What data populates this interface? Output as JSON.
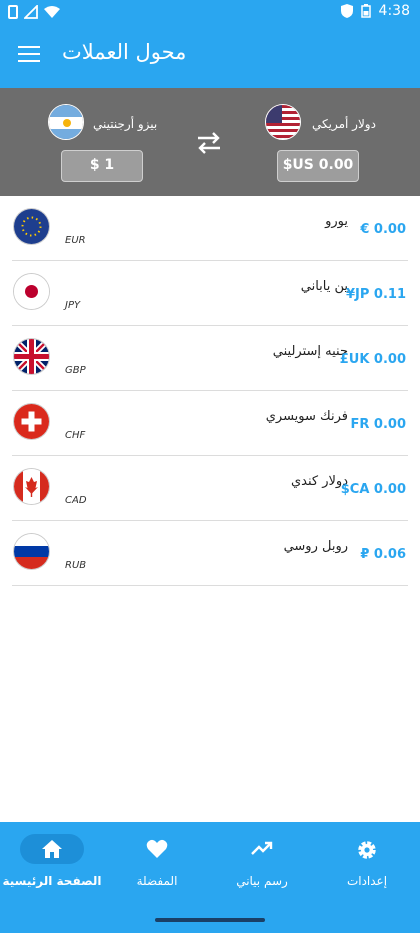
{
  "status_bar": {
    "time": "4:38"
  },
  "app_bar": {
    "title": "محول العملات"
  },
  "converter": {
    "from": {
      "name": "بيزو أرجنتيني",
      "amount": "$ 1",
      "flag": "argentina-flag"
    },
    "to": {
      "name": "دولار أمريكي",
      "amount": "$US 0.00",
      "flag": "usa-flag"
    }
  },
  "currencies": [
    {
      "name": "يورو",
      "code": "EUR",
      "value": "€ 0.00",
      "flag": "eu-flag"
    },
    {
      "name": "ين ياباني",
      "code": "JPY",
      "value": "¥JP 0.11",
      "flag": "japan-flag"
    },
    {
      "name": "جنيه إسترليني",
      "code": "GBP",
      "value": "£UK 0.00",
      "flag": "uk-flag"
    },
    {
      "name": "فرنك سويسري",
      "code": "CHF",
      "value": "FR 0.00",
      "flag": "switzerland-flag"
    },
    {
      "name": "دولار كندي",
      "code": "CAD",
      "value": "$CA 0.00",
      "flag": "canada-flag"
    },
    {
      "name": "روبل روسي",
      "code": "RUB",
      "value": "₽ 0.06",
      "flag": "russia-flag"
    }
  ],
  "bottom_nav": [
    {
      "label": "الصفحة الرئيسية",
      "icon": "home-icon",
      "active": true
    },
    {
      "label": "المفضلة",
      "icon": "heart-icon"
    },
    {
      "label": "رسم بياني",
      "icon": "trending-up-icon"
    },
    {
      "label": "إعدادات",
      "icon": "gear-icon"
    }
  ],
  "colors": {
    "primary": "#2aa6f0",
    "converter_bg": "#6d6d6d",
    "value_text": "#2aa6f0"
  }
}
